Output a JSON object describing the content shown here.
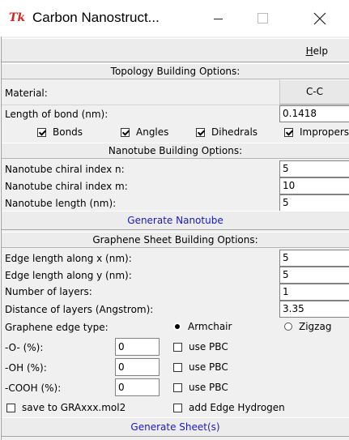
{
  "window": {
    "title": "Carbon Nanostruct...",
    "icon": "tk-feather-icon",
    "icon_text": "Tk",
    "controls": [
      "minimize",
      "maximize",
      "close"
    ]
  },
  "menu": {
    "help_label": "Help"
  },
  "topology": {
    "header": "Topology Building Options:",
    "material_label": "Material:",
    "material_value": "C-C",
    "bond_length_label": "Length of bond (nm):",
    "bond_length_value": "0.1418",
    "checkboxes": [
      {
        "label": "Bonds",
        "checked": true
      },
      {
        "label": "Angles",
        "checked": true
      },
      {
        "label": "Dihedrals",
        "checked": true
      },
      {
        "label": "Impropers",
        "checked": true
      }
    ]
  },
  "nanotube": {
    "header": "Nanotube Building Options:",
    "chiral_n_label": "Nanotube chiral index n:",
    "chiral_n_value": "5",
    "chiral_m_label": "Nanotube chiral index m:",
    "chiral_m_value": "10",
    "length_label": "Nanotube length (nm):",
    "length_value": "5",
    "generate_label": "Generate Nanotube"
  },
  "graphene": {
    "header": "Graphene Sheet Building Options:",
    "edge_x_label": "Edge length along x (nm):",
    "edge_x_value": "5",
    "edge_y_label": "Edge length along y (nm):",
    "edge_y_value": "5",
    "layers_label": "Number of layers:",
    "layers_value": "1",
    "distance_label": "Distance of layers (Angstrom):",
    "distance_value": "3.35",
    "edge_type_label": "Graphene edge type:",
    "edge_types": [
      {
        "label": "Armchair",
        "selected": true
      },
      {
        "label": "Zigzag",
        "selected": false
      }
    ],
    "o_label": "-O- (%):",
    "o_value": "0",
    "oh_label": "-OH (%):",
    "oh_value": "0",
    "cooh_label": "-COOH (%):",
    "cooh_value": "0",
    "pbc_label": "use PBC",
    "pbc_checked": [
      false,
      false,
      false
    ],
    "save_label": "save to GRAxxx.mol2",
    "save_checked": false,
    "edge_hydrogen_label": "add Edge Hydrogen",
    "edge_hydrogen_checked": false,
    "generate_label": "Generate Sheet(s)"
  },
  "colors": {
    "link_blue": "#1a1ab8",
    "tk_red": "#d8231f",
    "panel_bg": "#f0f0f0"
  }
}
